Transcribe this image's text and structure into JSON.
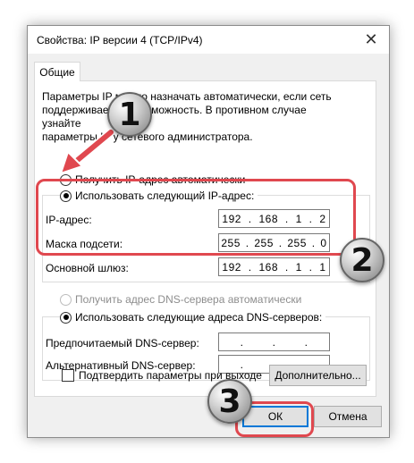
{
  "window": {
    "title": "Свойства: IP версии 4 (TCP/IPv4)",
    "close_symbol": "✕"
  },
  "tab": {
    "label": "Общие"
  },
  "description": "Параметры IP можно назначать автоматически, если сеть\nподдерживает эту возможность. В противном случае узнайте\nпараметры IP у сетевого администратора.",
  "ip_section": {
    "auto_label": "Получить IP-адрес автоматически",
    "manual_label": "Использовать следующий IP-адрес:",
    "fields": [
      {
        "label": "IP-адрес:",
        "octets": [
          "192",
          "168",
          "1",
          "2"
        ]
      },
      {
        "label": "Маска подсети:",
        "octets": [
          "255",
          "255",
          "255",
          "0"
        ]
      },
      {
        "label": "Основной шлюз:",
        "octets": [
          "192",
          "168",
          "1",
          "1"
        ]
      }
    ]
  },
  "dns_section": {
    "auto_label": "Получить адрес DNS-сервера автоматически",
    "manual_label": "Использовать следующие адреса DNS-серверов:",
    "fields": [
      {
        "label": "Предпочитаемый DNS-сервер:"
      },
      {
        "label": "Альтернативный DNS-сервер:"
      }
    ]
  },
  "validate_label": "Подтвердить параметры при выходе",
  "buttons": {
    "advanced": "Дополнительно...",
    "ok": "ОК",
    "cancel": "Отмена"
  },
  "badges": [
    "1",
    "2",
    "3"
  ],
  "colors": {
    "highlight": "#e0484f",
    "accent": "#0078d7"
  }
}
